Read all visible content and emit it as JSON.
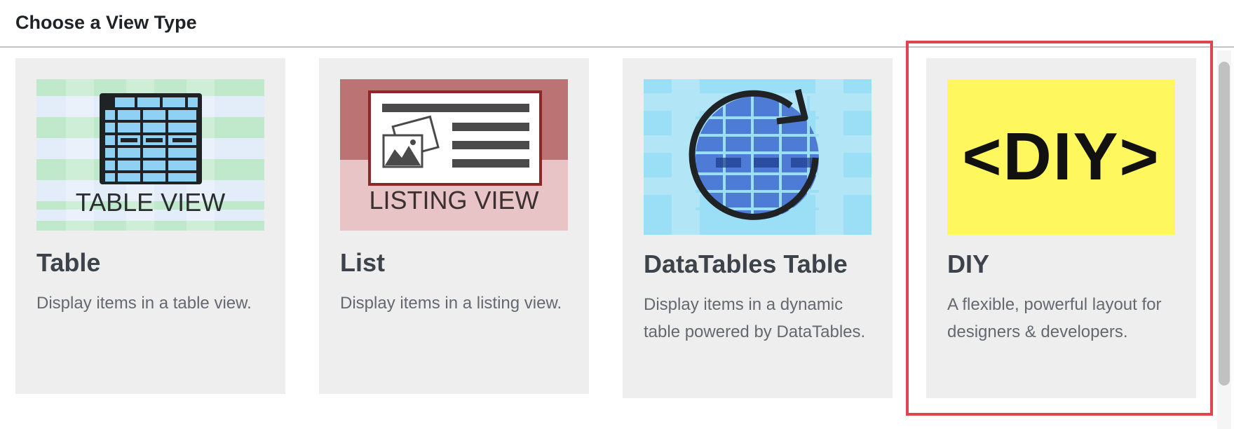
{
  "header": {
    "title": "Choose a View Type"
  },
  "cards": [
    {
      "image_label": "TABLE VIEW",
      "title": "Table",
      "description": "Display items in a table view."
    },
    {
      "image_label": "LISTING VIEW",
      "title": "List",
      "description": "Display items in a listing view."
    },
    {
      "title": "DataTables Table",
      "description": "Display items in a dynamic table powered by DataTables."
    },
    {
      "image_label": "<DIY>",
      "title": "DIY",
      "description": "A flexible, powerful layout for designers & developers.",
      "selected": true
    }
  ],
  "colors": {
    "highlight": "#e0444e",
    "card_bg": "#eeeeee",
    "diy_yellow": "#fff75e"
  }
}
